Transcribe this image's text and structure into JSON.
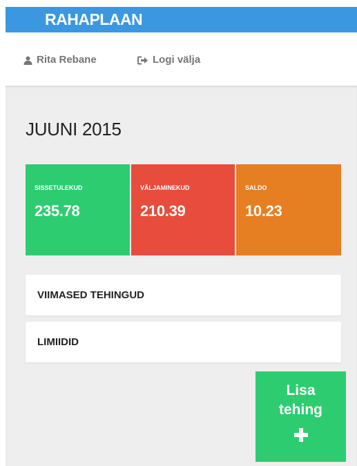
{
  "app": {
    "brand": "RAHAPLAAN"
  },
  "userbar": {
    "user_name": "Rita Rebane",
    "user_icon": "user-icon",
    "logout_label": "Logi välja",
    "logout_icon": "sign-out-icon"
  },
  "main": {
    "title": "JUUNI 2015",
    "stats": [
      {
        "label": "SISSETULEKUD",
        "value": "235.78",
        "color": "#2ecc71"
      },
      {
        "label": "VÄLJAMINEKUD",
        "value": "210.39",
        "color": "#e74c3c"
      },
      {
        "label": "SALDO",
        "value": "10.23",
        "color": "#e67e22"
      }
    ],
    "panels": [
      {
        "label": "VIIMASED TEHINGUD"
      },
      {
        "label": "LIMIIDID"
      }
    ],
    "add_button": {
      "line1": "Lisa",
      "line2": "tehing",
      "icon": "plus-icon",
      "color": "#2ecc71"
    }
  },
  "colors": {
    "header": "#3b97e0",
    "background": "#eeeeee"
  }
}
